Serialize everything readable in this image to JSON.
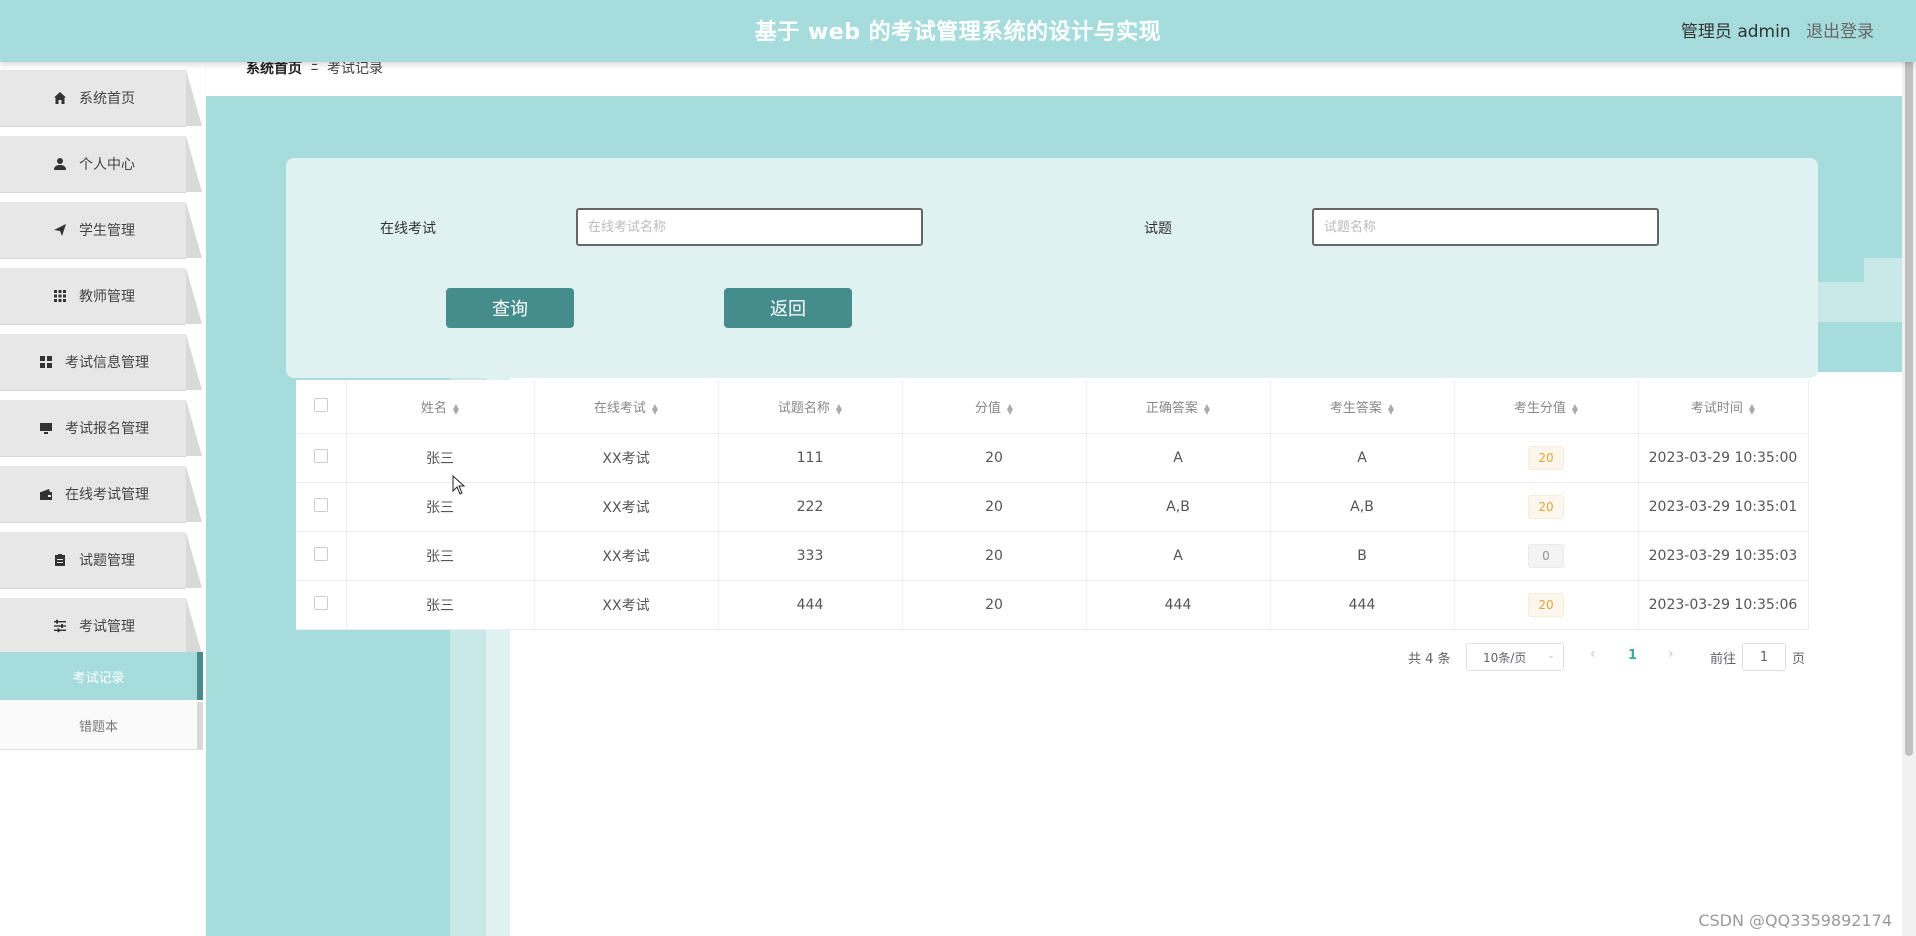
{
  "header": {
    "title": "基于 web 的考试管理系统的设计与实现",
    "user": "管理员 admin",
    "logout": "退出登录"
  },
  "sidebar": {
    "items": [
      {
        "label": "系统首页",
        "icon": "home-icon"
      },
      {
        "label": "个人中心",
        "icon": "user-icon"
      },
      {
        "label": "学生管理",
        "icon": "paper-plane-icon"
      },
      {
        "label": "教师管理",
        "icon": "grid-icon"
      },
      {
        "label": "考试信息管理",
        "icon": "apps-icon"
      },
      {
        "label": "考试报名管理",
        "icon": "monitor-icon"
      },
      {
        "label": "在线考试管理",
        "icon": "wallet-icon"
      },
      {
        "label": "试题管理",
        "icon": "clipboard-icon"
      },
      {
        "label": "考试管理",
        "icon": "sliders-icon"
      }
    ],
    "submenu": [
      {
        "label": "考试记录",
        "active": true
      },
      {
        "label": "错题本",
        "active": false
      }
    ]
  },
  "breadcrumb": {
    "home": "系统首页",
    "separator": "Ξ",
    "current": "考试记录"
  },
  "search": {
    "exam_label": "在线考试",
    "exam_placeholder": "在线考试名称",
    "question_label": "试题",
    "question_placeholder": "试题名称",
    "query_button": "查询",
    "back_button": "返回"
  },
  "table": {
    "columns": [
      "姓名",
      "在线考试",
      "试题名称",
      "分值",
      "正确答案",
      "考生答案",
      "考生分值",
      "考试时间"
    ],
    "rows": [
      {
        "name": "张三",
        "exam": "XX考试",
        "question": "111",
        "points": "20",
        "correct": "A",
        "answer": "A",
        "score": "20",
        "time": "2023-03-29 10:35:00"
      },
      {
        "name": "张三",
        "exam": "XX考试",
        "question": "222",
        "points": "20",
        "correct": "A,B",
        "answer": "A,B",
        "score": "20",
        "time": "2023-03-29 10:35:01"
      },
      {
        "name": "张三",
        "exam": "XX考试",
        "question": "333",
        "points": "20",
        "correct": "A",
        "answer": "B",
        "score": "0",
        "time": "2023-03-29 10:35:03"
      },
      {
        "name": "张三",
        "exam": "XX考试",
        "question": "444",
        "points": "20",
        "correct": "444",
        "answer": "444",
        "score": "20",
        "time": "2023-03-29 10:35:06"
      }
    ]
  },
  "pagination": {
    "total": "共 4 条",
    "page_size": "10条/页",
    "current_page": "1",
    "goto_label": "前往",
    "goto_value": "1",
    "page_suffix": "页"
  },
  "watermark": "CSDN @QQ3359892174",
  "colors": {
    "header_bg": "#a7dcdc",
    "accent": "#458c8c",
    "panel_bg": "#dff1f0",
    "tag_warn": "#e6a23c"
  }
}
